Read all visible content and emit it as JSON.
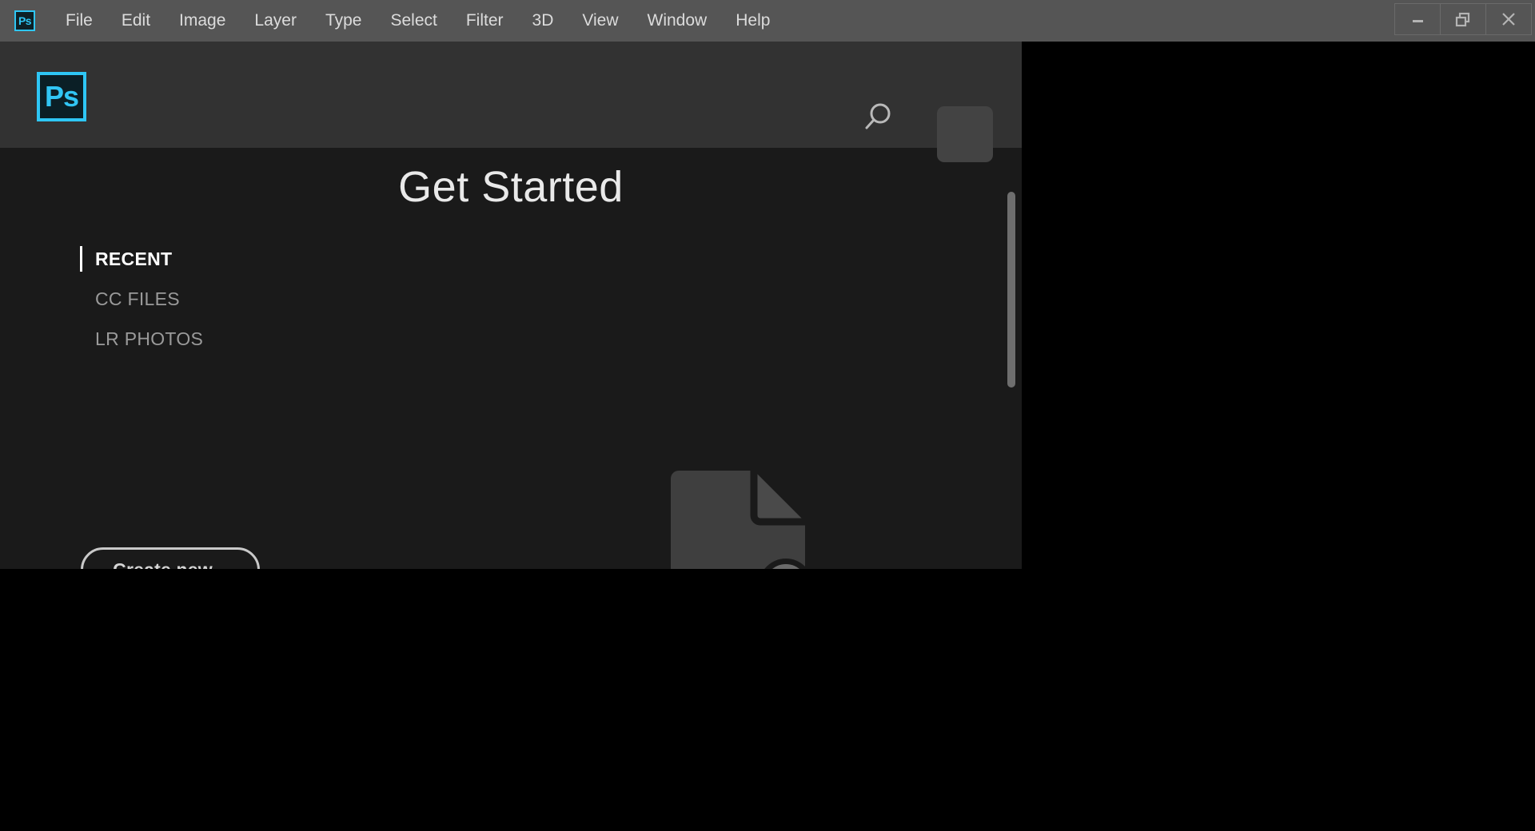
{
  "app": {
    "name": "Adobe Photoshop",
    "logo_text": "Ps",
    "logo_icon": "photoshop-logo-icon",
    "accent_color": "#2ec6f5",
    "logo_fill_color": "#0d2026"
  },
  "menubar": {
    "background_color": "#555555",
    "text_color": "#dcdcdc",
    "items": [
      {
        "label": "File"
      },
      {
        "label": "Edit"
      },
      {
        "label": "Image"
      },
      {
        "label": "Layer"
      },
      {
        "label": "Type"
      },
      {
        "label": "Select"
      },
      {
        "label": "Filter"
      },
      {
        "label": "3D"
      },
      {
        "label": "View"
      },
      {
        "label": "Window"
      },
      {
        "label": "Help"
      }
    ]
  },
  "window_controls": {
    "minimize": {
      "icon": "minimize-icon",
      "label": "Minimize"
    },
    "restore": {
      "icon": "restore-icon",
      "label": "Restore"
    },
    "close": {
      "icon": "close-icon",
      "label": "Close"
    }
  },
  "start_workspace": {
    "header": {
      "background_color": "#323232",
      "search_icon": "search-icon",
      "avatar": {
        "icon": "avatar-placeholder-icon",
        "color": "#434343"
      }
    },
    "body": {
      "background_color": "#1a1a1a",
      "title": "Get Started",
      "nav": [
        {
          "label": "RECENT",
          "active": true
        },
        {
          "label": "CC FILES",
          "active": false
        },
        {
          "label": "LR PHOTOS",
          "active": false
        }
      ],
      "create_new_label": "Create new...",
      "new_document_icon": "new-document-icon",
      "scrollbar": {
        "thumb_color": "#6e6e6e"
      }
    }
  },
  "canvas": {
    "background_color": "#000000"
  }
}
